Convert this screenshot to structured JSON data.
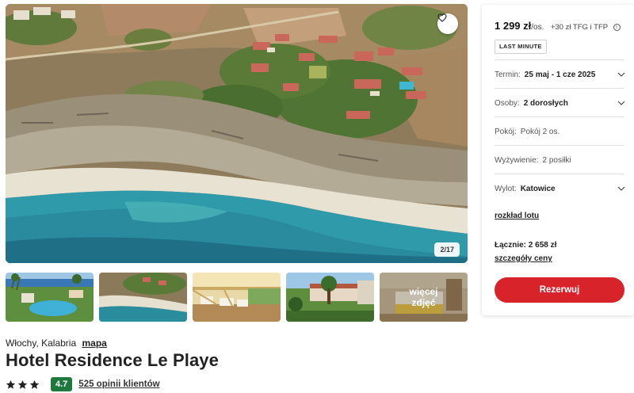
{
  "gallery": {
    "counter": "2/17",
    "more_label": "więcej zdjęć"
  },
  "hotel": {
    "location": "Włochy, Kalabria",
    "map_link": "mapa",
    "name": "Hotel Residence Le Playe",
    "stars": 3,
    "score": "4.7",
    "reviews": "525 opinii klientów"
  },
  "booking": {
    "price": "1 299 zł",
    "per": "/os.",
    "extra": "+30 zł TFG i TFP",
    "badge": "LAST MINUTE",
    "term_label": "Termin:",
    "term_value": "25 maj - 1 cze 2025",
    "people_label": "Osoby:",
    "people_value": "2 dorosłych",
    "room_label": "Pokój:",
    "room_value": "Pokój 2 os.",
    "board_label": "Wyżywienie:",
    "board_value": "2 posiłki",
    "departure_label": "Wylot:",
    "departure_value": "Katowice",
    "flight_link": "rozkład lotu",
    "total_label": "Łącznie: 2 658 zł",
    "price_details_link": "szczegóły ceny",
    "reserve_button": "Rezerwuj"
  },
  "colors": {
    "accent": "#d8232a",
    "score_badge": "#1e7a3c"
  },
  "icons": [
    "heart-icon",
    "star-icon",
    "chevron-down-icon",
    "info-icon"
  ]
}
